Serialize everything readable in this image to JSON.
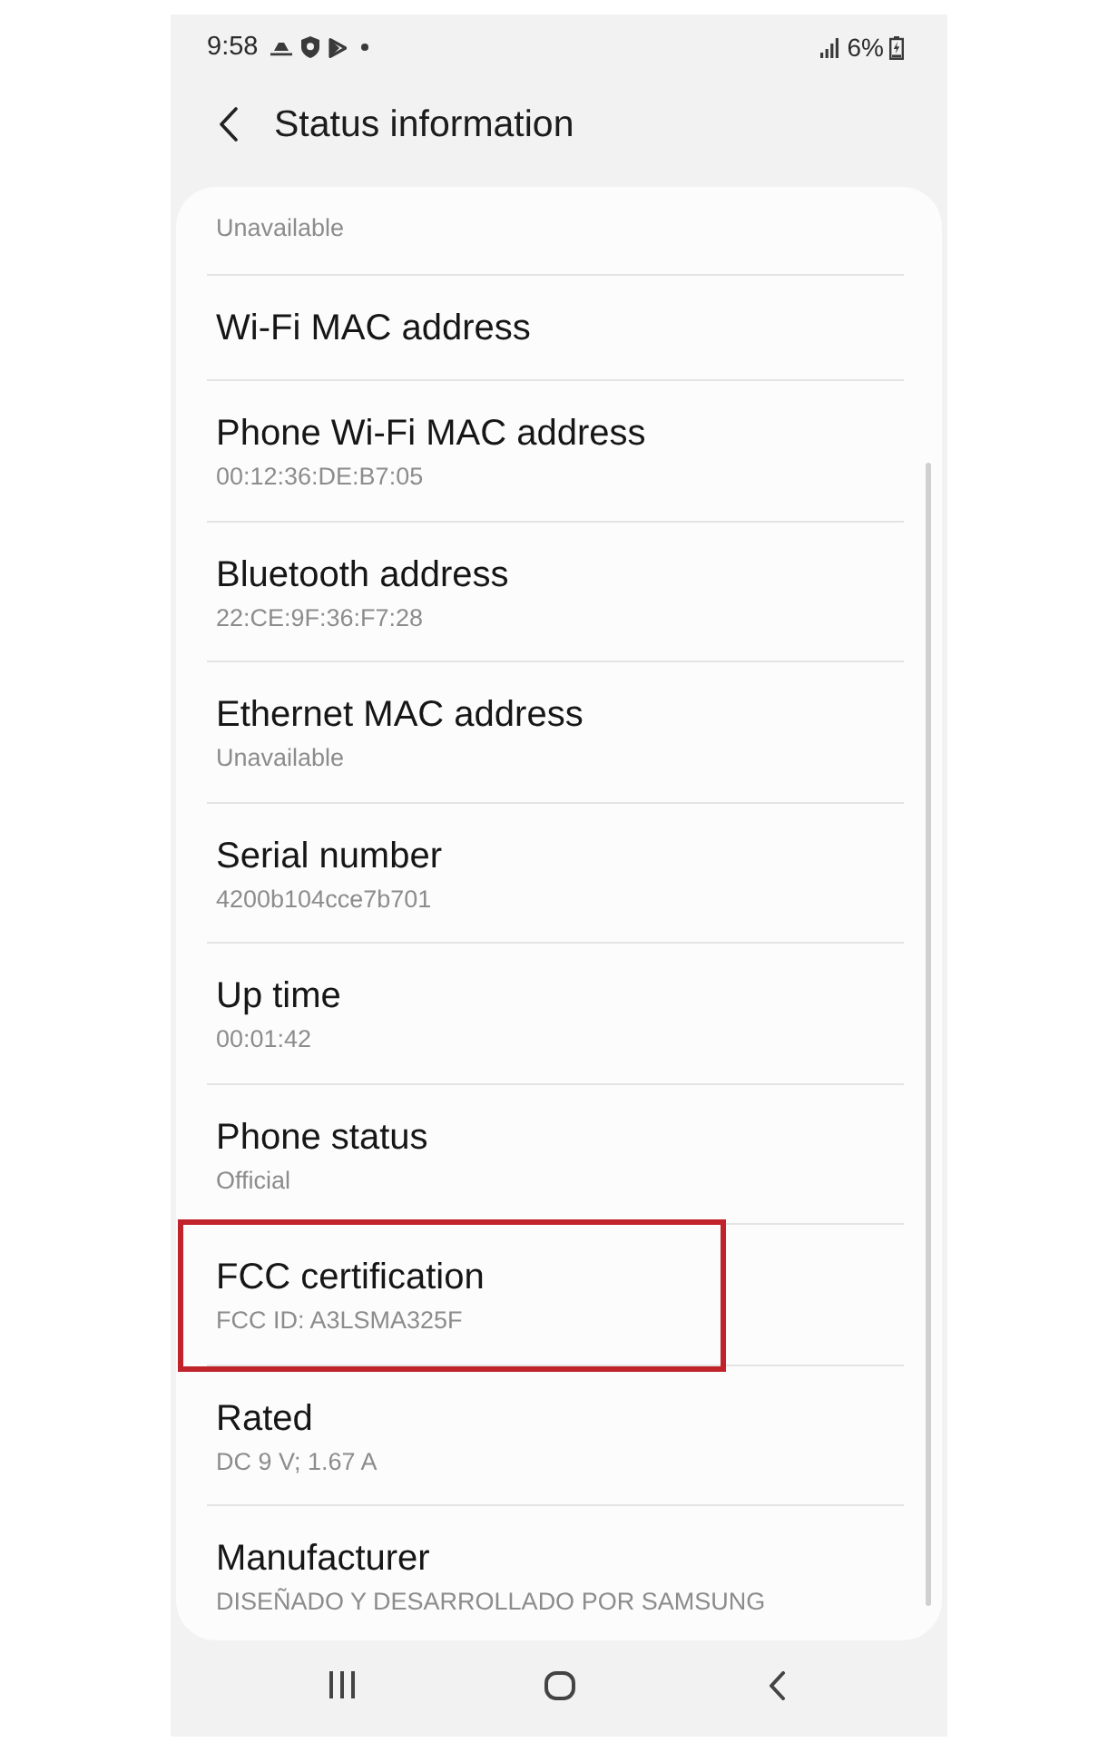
{
  "status_bar": {
    "time": "9:58",
    "battery": "6%"
  },
  "header": {
    "title": "Status information"
  },
  "items": [
    {
      "value": "Unavailable",
      "highlighted": false
    },
    {
      "title": "Wi-Fi MAC address",
      "highlighted": false
    },
    {
      "title": "Phone Wi-Fi MAC address",
      "value": "00:12:36:DE:B7:05",
      "highlighted": false
    },
    {
      "title": "Bluetooth address",
      "value": "22:CE:9F:36:F7:28",
      "highlighted": false
    },
    {
      "title": "Ethernet MAC address",
      "value": "Unavailable",
      "highlighted": false
    },
    {
      "title": "Serial number",
      "value": "4200b104cce7b701",
      "highlighted": false
    },
    {
      "title": "Up time",
      "value": "00:01:42",
      "highlighted": false
    },
    {
      "title": "Phone status",
      "value": "Official",
      "highlighted": false
    },
    {
      "title": "FCC certification",
      "value": "FCC ID: A3LSMA325F",
      "highlighted": true
    },
    {
      "title": "Rated",
      "value": "DC 9 V; 1.67 A",
      "highlighted": false
    },
    {
      "title": "Manufacturer",
      "value": "DISEÑADO Y DESARROLLADO POR SAMSUNG",
      "highlighted": false
    }
  ]
}
